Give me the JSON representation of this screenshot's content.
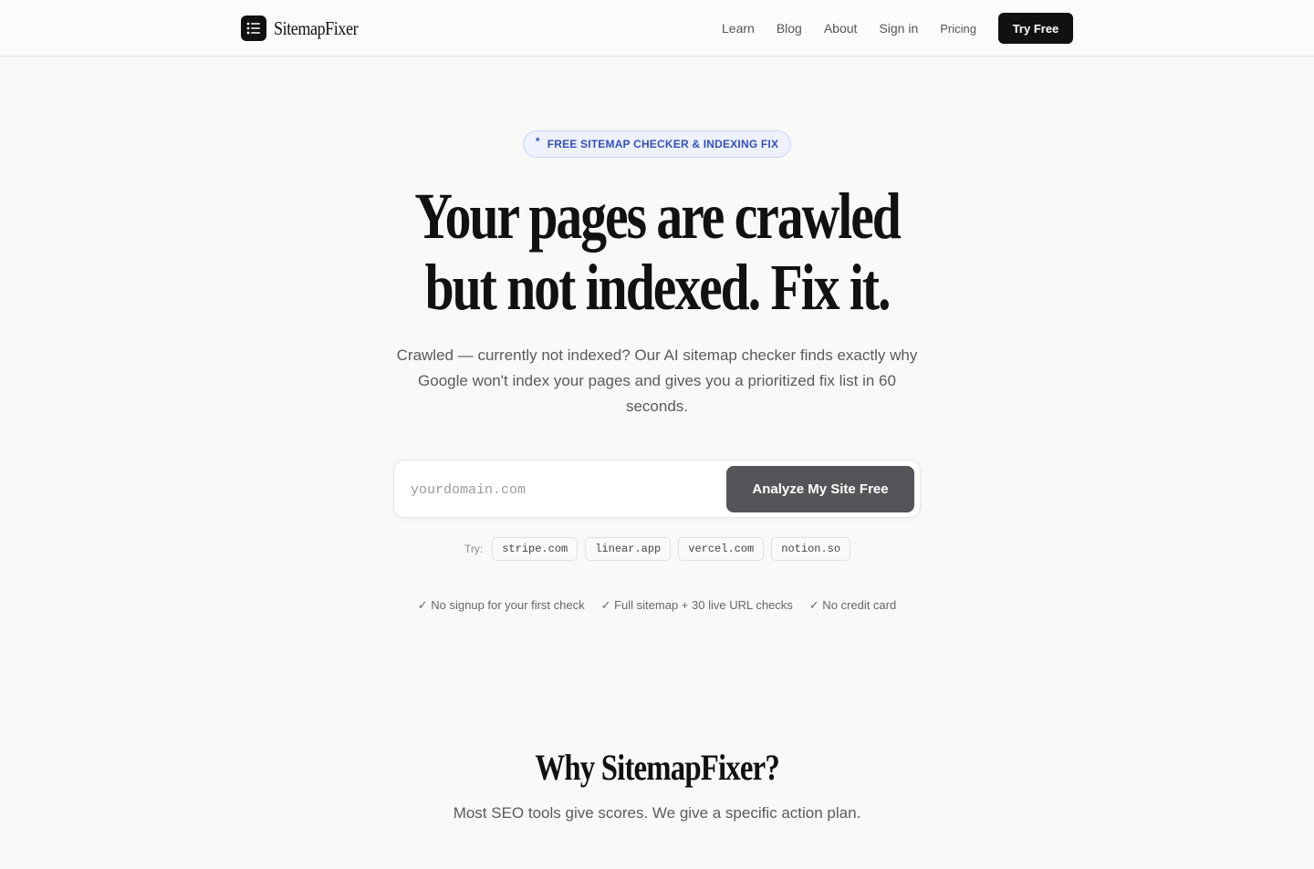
{
  "header": {
    "brand": "SitemapFixer",
    "nav": [
      "Learn",
      "Blog",
      "About",
      "Sign in",
      "Pricing"
    ],
    "cta": "Try Free"
  },
  "hero": {
    "badge": "FREE SITEMAP CHECKER & INDEXING FIX",
    "headline_line1": "Your pages are crawled",
    "headline_line2": "but not indexed. Fix it.",
    "subtext": "Crawled — currently not indexed? Our AI sitemap checker finds exactly why Google won't index your pages and gives you a prioritized fix list in 60 seconds.",
    "search": {
      "placeholder": "yourdomain.com",
      "button": "Analyze My Site Free"
    },
    "try_label": "Try:",
    "examples": [
      "stripe.com",
      "linear.app",
      "vercel.com",
      "notion.so"
    ],
    "checks": [
      "✓ No signup for your first check",
      "✓ Full sitemap + 30 live URL checks",
      "✓ No credit card"
    ]
  },
  "why": {
    "title": "Why SitemapFixer?",
    "subtitle": "Most SEO tools give scores. We give a specific action plan."
  },
  "colors": {
    "accent": "#3550b8",
    "badge_bg": "#eef1fe",
    "primary_button": "#111111",
    "analyze_button": "#545459",
    "background": "#f9f9f8"
  }
}
